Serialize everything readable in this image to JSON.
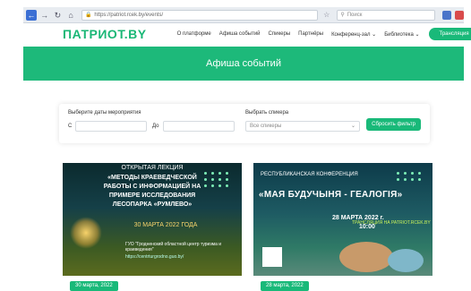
{
  "browser": {
    "url": "https://patriot.rcek.by/events/",
    "search_placeholder": "Поиск"
  },
  "header": {
    "logo": "ПАТРИОТ.BY",
    "nav": [
      "О платформе",
      "Афиша событий",
      "Спикеры",
      "Партнёры",
      "Конференц-зал ⌄",
      "Библиотека ⌄"
    ],
    "live_button": "Трансляция"
  },
  "hero": {
    "title": "Афиша событий"
  },
  "filter": {
    "dates_label": "Выберите даты мероприятия",
    "from_prefix": "С",
    "to_prefix": "До",
    "speaker_label": "Выбрать спикера",
    "speaker_placeholder": "Все спикеры",
    "reset_button": "Сбросить фильтр"
  },
  "events": [
    {
      "line1": "ОТКРЫТАЯ ЛЕКЦИЯ",
      "line2": "«МЕТОДЫ КРАЕВЕДЧЕСКОЙ",
      "line3": "РАБОТЫ С ИНФОРМАЦИЕЙ НА",
      "line4": "ПРИМЕРЕ ИССЛЕДОВАНИЯ",
      "line5": "ЛЕСОПАРКА «РУМЛЕВО»",
      "when": "30 МАРТА 2022 ГОДА",
      "org": "ГУО \"Гродненский областной центр туризма и краеведения\"",
      "site": "https://centrturgrodno.guo.by/",
      "date_badge": "30 марта, 2022"
    },
    {
      "line1": "РЕСПУБЛИКАНСКАЯ КОНФЕРЕНЦИЯ",
      "line2": "«МАЯ БУДУЧЫНЯ - ГЕАЛОГІЯ»",
      "when": "28 МАРТА 2022 г.",
      "time": "10:00",
      "broadcast": "ТРАНСЛЯЦИЯ НА PATRIOT.RCEK.BY",
      "date_badge": "28 марта, 2022"
    }
  ]
}
